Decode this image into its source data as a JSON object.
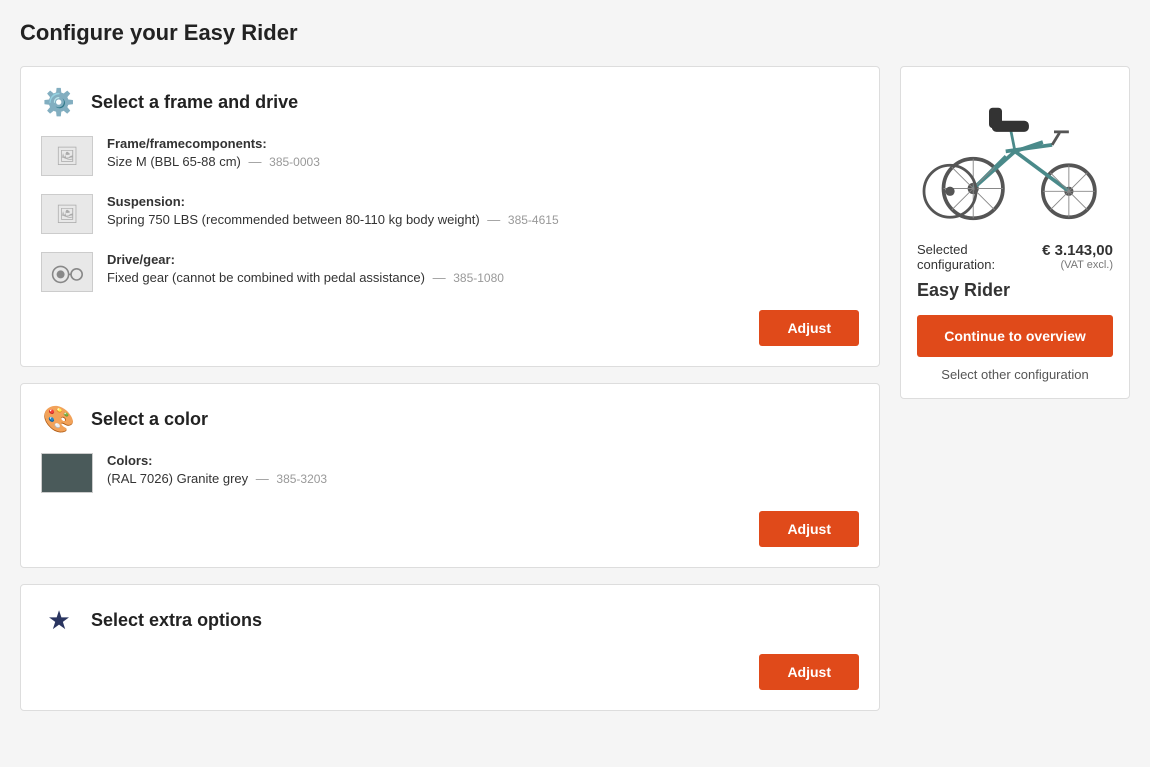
{
  "page": {
    "title": "Configure your Easy Rider"
  },
  "sections": [
    {
      "id": "frame-drive",
      "icon": "⚙",
      "title": "Select a frame and drive",
      "items": [
        {
          "label": "Frame/framecomponents:",
          "value": "Size M (BBL 65-88 cm)",
          "code": "385-0003",
          "hasImage": false
        },
        {
          "label": "Suspension:",
          "value": "Spring 750 LBS (recommended between 80-110 kg body weight)",
          "code": "385-4615",
          "hasImage": false
        },
        {
          "label": "Drive/gear:",
          "value": "Fixed gear (cannot be combined with pedal assistance)",
          "code": "385-1080",
          "hasImage": true
        }
      ],
      "adjustBtn": "Adjust"
    },
    {
      "id": "color",
      "icon": "🎨",
      "title": "Select a color",
      "items": [
        {
          "label": "Colors:",
          "value": "(RAL 7026) Granite grey",
          "code": "385-3203",
          "isColor": true,
          "colorHex": "#4a5a5a"
        }
      ],
      "adjustBtn": "Adjust"
    },
    {
      "id": "extra-options",
      "icon": "★",
      "title": "Select extra options",
      "items": [],
      "adjustBtn": "Adjust"
    }
  ],
  "sidebar": {
    "selectedLabel": "Selected",
    "configLabel": "configuration:",
    "price": "€ 3.143,00",
    "vatLabel": "(VAT excl.)",
    "productName": "Easy Rider",
    "continueBtn": "Continue to overview",
    "selectOtherLink": "Select other configuration"
  }
}
